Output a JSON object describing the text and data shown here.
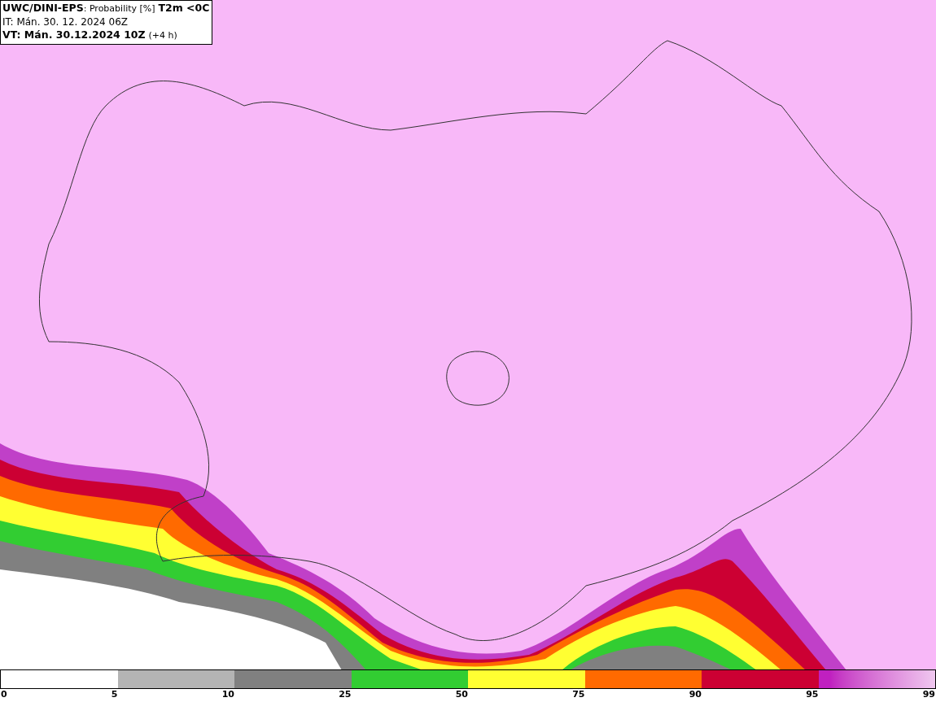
{
  "header": {
    "model": "UWC/DINI-EPS",
    "product": ": Probability [%]",
    "variable": "T2m <0C",
    "issue_time": "IT: Mán. 30. 12. 2024 06Z",
    "valid_time": "VT: Mán. 30.12.2024 10Z",
    "lead": "(+4 h)"
  },
  "legend": {
    "segments": [
      {
        "color": "#ffffff"
      },
      {
        "color": "#b4b4b4"
      },
      {
        "color": "#808080"
      },
      {
        "color": "#32cd32"
      },
      {
        "color": "#ffff32"
      },
      {
        "color": "#ff6a00"
      },
      {
        "color": "#cc0033"
      },
      {
        "color": "#c020c0",
        "kind": "gradient"
      }
    ],
    "ticks": [
      "0",
      "5",
      "10",
      "25",
      "50",
      "75",
      "90",
      "95",
      "99"
    ]
  }
}
